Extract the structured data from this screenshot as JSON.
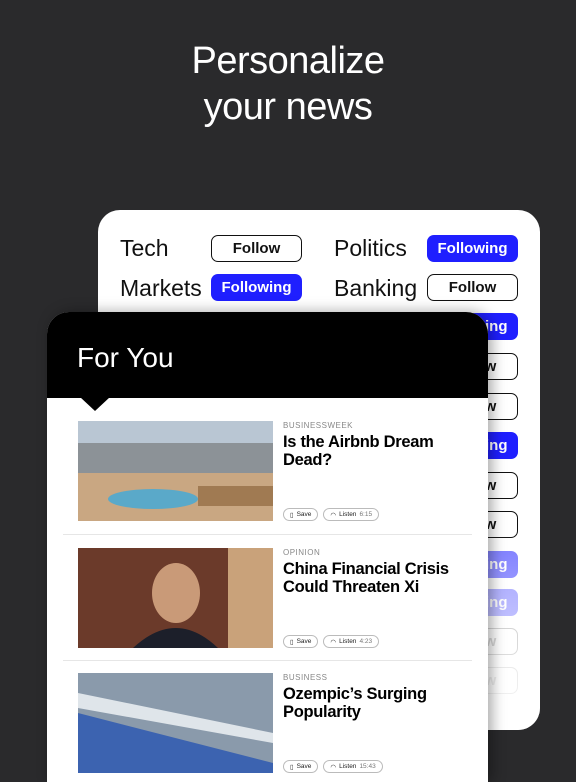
{
  "headline": {
    "line1": "Personalize",
    "line2": "your news"
  },
  "topics": [
    {
      "name": "Tech",
      "state": "Follow"
    },
    {
      "name": "Politics",
      "state": "Following"
    },
    {
      "name": "Markets",
      "state": "Following"
    },
    {
      "name": "Banking",
      "state": "Follow"
    }
  ],
  "hidden_buttons": [
    "Following",
    "Follow",
    "Follow",
    "Following",
    "Follow",
    "Follow",
    "Following",
    "Following",
    "Follow",
    "Follow"
  ],
  "colors": {
    "accent": "#1f1fff",
    "background": "#2a2a2c"
  },
  "feed": {
    "title": "For You",
    "save_label": "Save",
    "listen_label": "Listen",
    "articles": [
      {
        "kicker": "BUSINESSWEEK",
        "title": "Is the Airbnb Dream Dead?",
        "duration": "6:15"
      },
      {
        "kicker": "OPINION",
        "title": "China Financial Crisis Could Threaten Xi",
        "duration": "4:23"
      },
      {
        "kicker": "BUSINESS",
        "title": "Ozempic’s Surging Popularity",
        "duration": "15:43"
      }
    ]
  }
}
